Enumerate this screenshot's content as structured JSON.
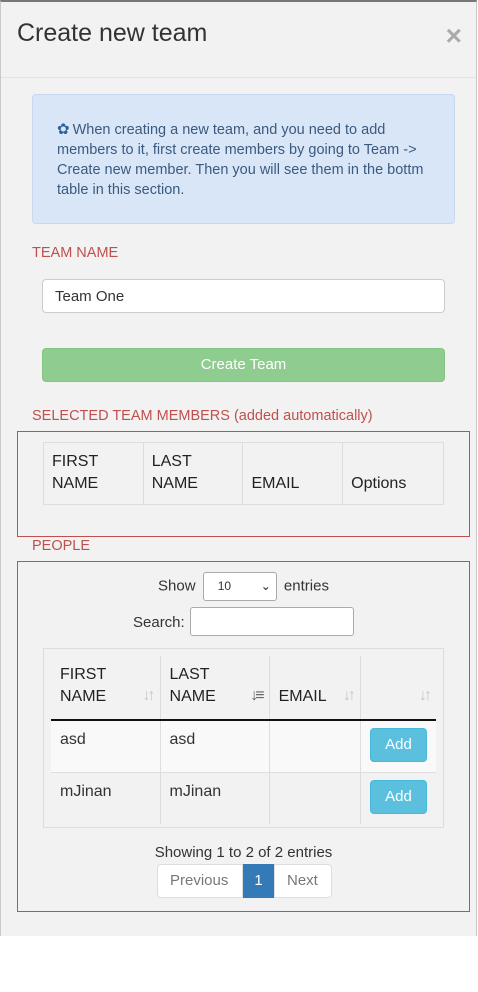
{
  "modal": {
    "title": "Create new team",
    "close_label": "×"
  },
  "info": {
    "icon": "gear-icon",
    "text": "When creating a new team, and you need to add members to it, first create members by going to Team -> Create new member. Then you will see them in the bottm table in this section."
  },
  "team_name": {
    "label": "TEAM NAME",
    "value": "Team One"
  },
  "create_button": {
    "label": "Create Team"
  },
  "selected_members": {
    "label": "SELECTED TEAM MEMBERS (added automatically)",
    "columns": [
      "FIRST NAME",
      "LAST NAME",
      "EMAIL",
      "Options"
    ]
  },
  "people": {
    "label": "PEOPLE",
    "show_label": "Show",
    "entries_label": "entries",
    "length_value": "10",
    "search_label": "Search:",
    "search_value": "",
    "columns": [
      "FIRST NAME",
      "LAST NAME",
      "EMAIL",
      ""
    ],
    "rows": [
      {
        "first": "asd",
        "last": "asd",
        "email": "",
        "action": "Add"
      },
      {
        "first": "mJinan",
        "last": "mJinan",
        "email": "",
        "action": "Add"
      }
    ],
    "info": "Showing 1 to 2 of 2 entries",
    "pagination": {
      "previous": "Previous",
      "current": "1",
      "next": "Next"
    }
  },
  "colors": {
    "accent_red": "#c0504d",
    "info_bg": "#d9e6f7",
    "success_btn": "#8fcc8f",
    "add_btn": "#5bc0de",
    "page_active": "#337ab7"
  }
}
